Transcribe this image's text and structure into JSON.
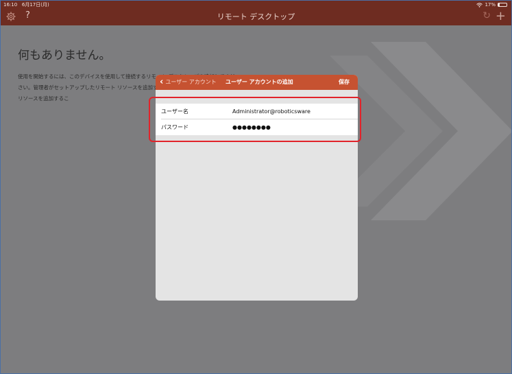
{
  "status_bar": {
    "time": "16:10",
    "date": "6月17日(月)",
    "battery_percent": "17%",
    "battery_level": 0.17
  },
  "nav_bar": {
    "title": "リモート デスクトップ",
    "help_glyph": "?",
    "refresh_glyph": "↻",
    "add_glyph": "+"
  },
  "empty_state": {
    "title": "何もありません。",
    "body": "使用を開始するには、このデバイスを使用して接続するリモート デスクトップを追加してください。管理者がセットアップしたリモート リソースを追加するこ ップと連携する、リモート リソースを追加するこ"
  },
  "modal": {
    "back_label": "ユーザー アカウント",
    "title": "ユーザー アカウントの追加",
    "save_label": "保存",
    "fields": {
      "username": {
        "label": "ユーザー名",
        "value": "Administrator@roboticsware"
      },
      "password": {
        "label": "パスワード",
        "value": "●●●●●●●●"
      }
    }
  },
  "colors": {
    "accent": "#c65231",
    "nav": "#6e2c21",
    "highlight": "#e1232a"
  },
  "icons": [
    "gear-icon",
    "help-icon",
    "refresh-icon",
    "add-icon",
    "back-chevron-icon",
    "wifi-icon",
    "battery-icon"
  ]
}
